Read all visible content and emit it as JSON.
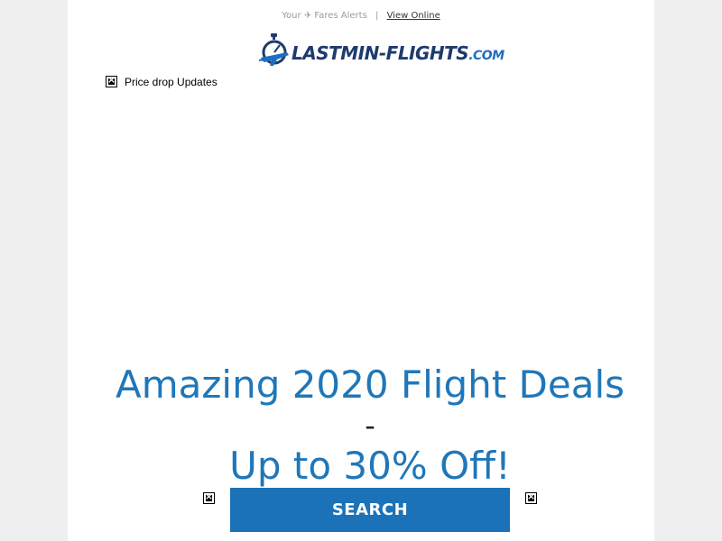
{
  "preheader": {
    "prefix": "Your",
    "plane_glyph": "✈",
    "alerts_text": "Fares Alerts",
    "separator": "|",
    "view_online_label": "View Online"
  },
  "logo": {
    "name": "LASTMIN-FLIGHTS",
    "tld": ".COM",
    "icon": "airplane-stopwatch-icon"
  },
  "banner_image": {
    "alt": "Price drop Updates",
    "icon": "broken-image-icon"
  },
  "headline": {
    "line1": "Amazing 2020 Flight Deals",
    "dash": "-",
    "line2": "Up to 30% Off!"
  },
  "cta": {
    "label": "SEARCH",
    "left_icon": "broken-image-icon",
    "right_icon": "broken-image-icon"
  },
  "colors": {
    "page_background": "#efefef",
    "content_background": "#ffffff",
    "accent_blue": "#1f77b9",
    "button_blue": "#1b72b8",
    "logo_navy": "#1e3a6e"
  }
}
